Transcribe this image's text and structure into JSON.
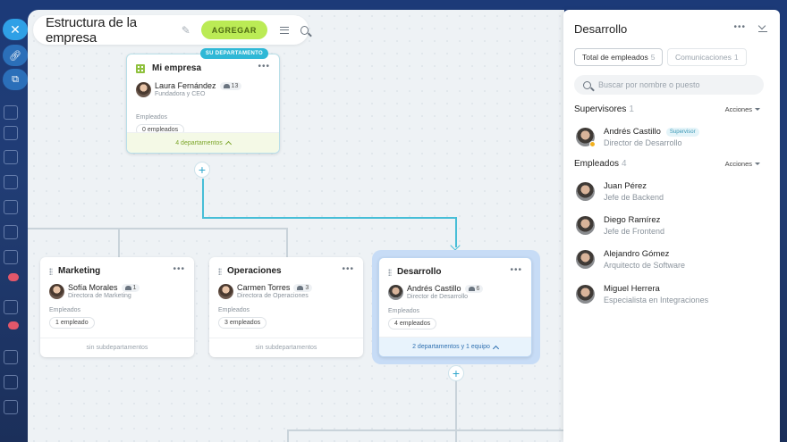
{
  "toolbar": {
    "title": "Estructura de la empresa",
    "add_label": "AGREGAR"
  },
  "root_card": {
    "tag": "SU DEPARTAMENTO",
    "name": "Mi empresa",
    "head_name": "Laura Fernández",
    "head_role": "Fundadora y CEO",
    "head_count": "13",
    "employees_label": "Empleados",
    "employees_value": "0 empleados",
    "footer": "4 departamentos"
  },
  "departments": [
    {
      "name": "Marketing",
      "head_name": "Sofía Morales",
      "head_role": "Directora de Marketing",
      "head_count": "1",
      "employees_label": "Empleados",
      "employees_value": "1 empleado",
      "footer": "sin subdepartamentos"
    },
    {
      "name": "Operaciones",
      "head_name": "Carmen Torres",
      "head_role": "Directora de Operaciones",
      "head_count": "3",
      "employees_label": "Empleados",
      "employees_value": "3 empleados",
      "footer": "sin subdepartamentos"
    },
    {
      "name": "Desarrollo",
      "head_name": "Andrés Castillo",
      "head_role": "Director de Desarrollo",
      "head_count": "6",
      "employees_label": "Empleados",
      "employees_value": "4 empleados",
      "footer": "2 departamentos y 1 equipo"
    }
  ],
  "panel": {
    "title": "Desarrollo",
    "tabs": [
      {
        "label": "Total de empleados",
        "count": "5"
      },
      {
        "label": "Comunicaciones",
        "count": "1"
      }
    ],
    "search_placeholder": "Buscar por nombre o puesto",
    "supervisors": {
      "label": "Supervisores",
      "count": "1",
      "actions": "Acciones",
      "items": [
        {
          "name": "Andrés Castillo",
          "role": "Director de Desarrollo",
          "badge": "Supervisor"
        }
      ]
    },
    "employees": {
      "label": "Empleados",
      "count": "4",
      "actions": "Acciones",
      "items": [
        {
          "name": "Juan Pérez",
          "role": "Jefe de Backend"
        },
        {
          "name": "Diego Ramírez",
          "role": "Jefe de Frontend"
        },
        {
          "name": "Alejandro Gómez",
          "role": "Arquitecto de Software"
        },
        {
          "name": "Miguel Herrera",
          "role": "Especialista en Integraciones"
        }
      ]
    }
  }
}
